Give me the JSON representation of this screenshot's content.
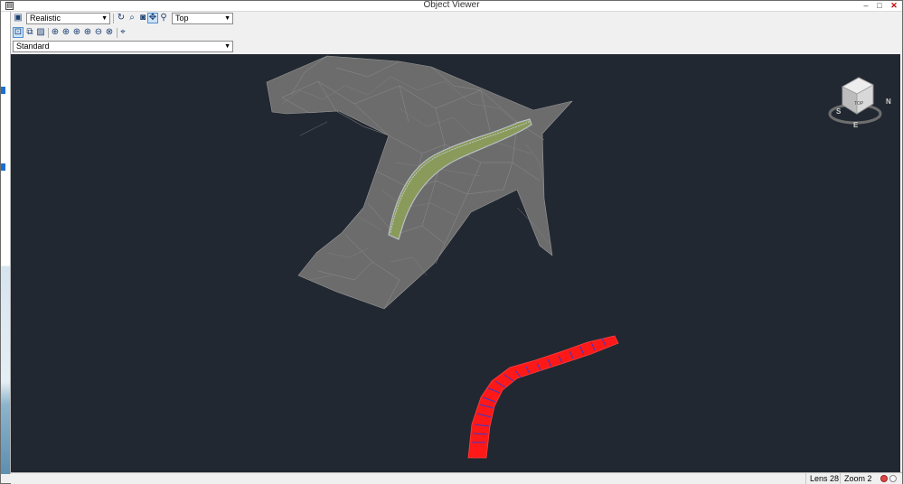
{
  "window": {
    "title": "Object Viewer",
    "minimize": "–",
    "maximize": "□",
    "close": "✕"
  },
  "toolbar": {
    "visual_style_value": "Realistic",
    "view_value": "Top",
    "view_style_value": "Standard"
  },
  "viewcube": {
    "face_label": "TOP",
    "compass_n": "N",
    "compass_s": "S",
    "compass_e": "E"
  },
  "status": {
    "lens": "Lens 28",
    "zoom": "Zoom 2"
  },
  "colors": {
    "viewport_bg": "#222831",
    "surface": "#6b6b6b",
    "corridor": "#8a9a5b",
    "alignment": "#ff1a1a",
    "accent": "#2a6fd1"
  }
}
